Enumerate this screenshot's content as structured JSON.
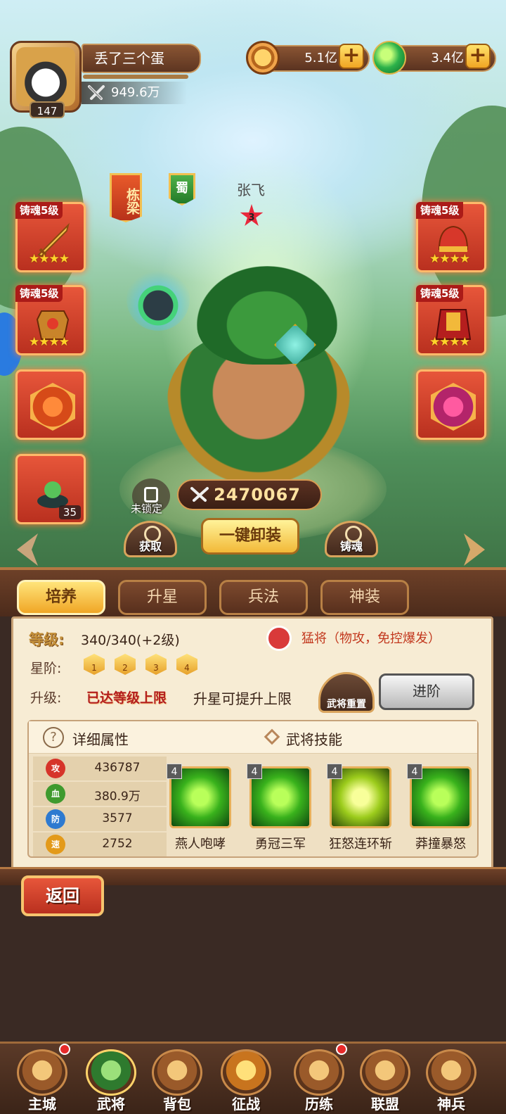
{
  "player": {
    "name": "丢了三个蛋",
    "level": "147",
    "power": "949.6万"
  },
  "resources": {
    "coins": "5.1亿",
    "jade": "3.4亿",
    "plus_label": "+"
  },
  "hero": {
    "title_tag": "栋梁",
    "faction": "蜀",
    "name": "张飞",
    "star_level": "3",
    "combat_power": "2470067"
  },
  "equipment": {
    "slot_tag": "铸魂5级",
    "stars": "★★★★",
    "pet_count": "35"
  },
  "actions": {
    "lock_label": "未锁定",
    "obtain_label": "获取",
    "unequip_all_label": "一键卸装",
    "soul_forge_label": "铸魂"
  },
  "tabs": [
    "培养",
    "升星",
    "兵法",
    "神装"
  ],
  "details": {
    "level_label": "等级:",
    "level_value": "340/340(+2级)",
    "role": "猛将（物攻，免控爆发）",
    "star_rank_label": "星阶:",
    "star_gems": [
      "1",
      "2",
      "3",
      "4"
    ],
    "upgrade_label": "升级:",
    "maxed_text": "已达等级上限",
    "hint_text": "升星可提升上限",
    "reset_label": "武将重置",
    "advance_label": "进阶"
  },
  "attributes": {
    "title": "详细属性",
    "rows": [
      {
        "icon": "攻",
        "value": "436787",
        "color": "#d6342a"
      },
      {
        "icon": "血",
        "value": "380.9万",
        "color": "#3f9a2e"
      },
      {
        "icon": "防",
        "value": "3577",
        "color": "#2e7ad0"
      },
      {
        "icon": "速",
        "value": "2752",
        "color": "#e39a1a"
      }
    ]
  },
  "skills": {
    "title": "武将技能",
    "items": [
      {
        "level": "4",
        "name": "燕人咆哮"
      },
      {
        "level": "4",
        "name": "勇冠三军"
      },
      {
        "level": "4",
        "name": "狂怒连环斩"
      },
      {
        "level": "4",
        "name": "莽撞暴怒"
      }
    ]
  },
  "back_label": "返回",
  "nav": [
    {
      "label": "主城"
    },
    {
      "label": "武将"
    },
    {
      "label": "背包"
    },
    {
      "label": "征战"
    },
    {
      "label": "历练"
    },
    {
      "label": "联盟"
    },
    {
      "label": "神兵"
    }
  ]
}
